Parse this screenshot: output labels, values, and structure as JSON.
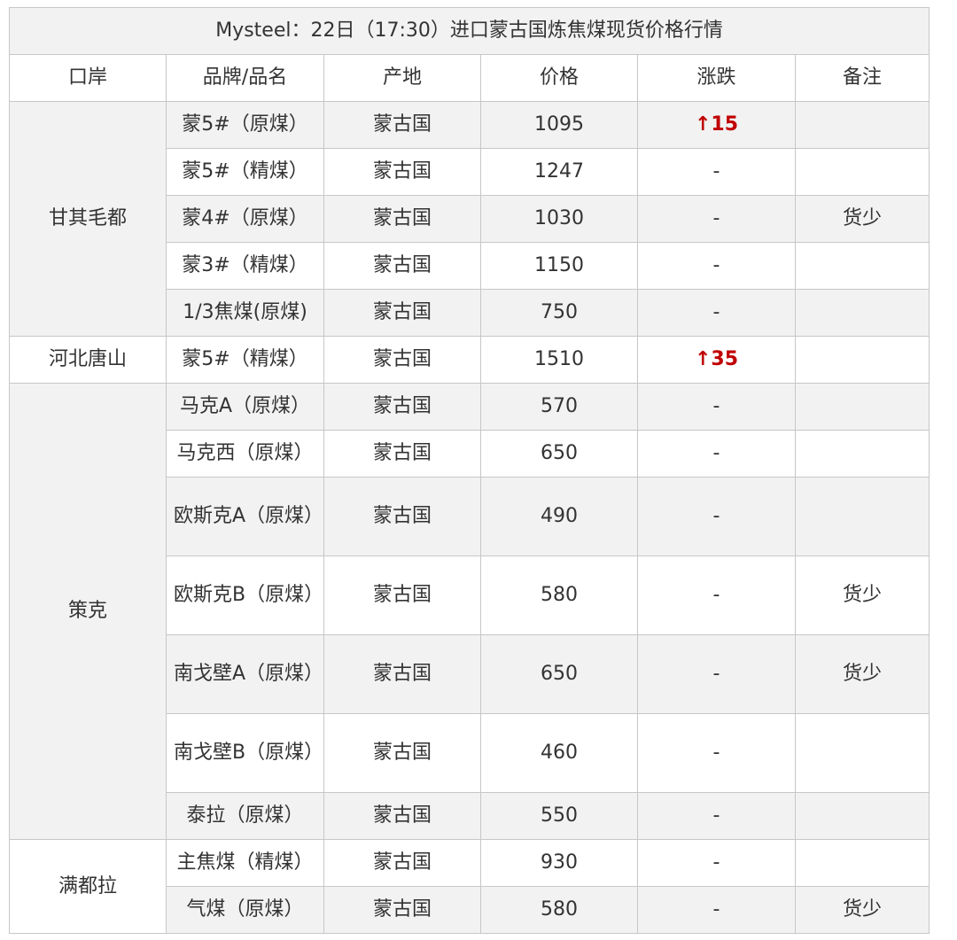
{
  "title": "Mysteel：22日（17:30）进口蒙古国炼焦煤现货价格行情",
  "columns": [
    "口岸",
    "品牌/品名",
    "产地",
    "价格",
    "涨跌",
    "备注"
  ],
  "up_color": "#c00000",
  "groups": [
    {
      "port": "甘其毛都",
      "rows": [
        {
          "brand": "蒙5#（原煤）",
          "origin": "蒙古国",
          "price": "1095",
          "change": "↑15",
          "note": ""
        },
        {
          "brand": "蒙5#（精煤）",
          "origin": "蒙古国",
          "price": "1247",
          "change": "-",
          "note": ""
        },
        {
          "brand": "蒙4#（原煤）",
          "origin": "蒙古国",
          "price": "1030",
          "change": "-",
          "note": "货少"
        },
        {
          "brand": "蒙3#（精煤）",
          "origin": "蒙古国",
          "price": "1150",
          "change": "-",
          "note": ""
        },
        {
          "brand": "1/3焦煤(原煤)",
          "origin": "蒙古国",
          "price": "750",
          "change": "-",
          "note": ""
        }
      ]
    },
    {
      "port": "河北唐山",
      "rows": [
        {
          "brand": "蒙5#（精煤）",
          "origin": "蒙古国",
          "price": "1510",
          "change": "↑35",
          "note": ""
        }
      ]
    },
    {
      "port": "策克",
      "rows": [
        {
          "brand": "马克A（原煤）",
          "origin": "蒙古国",
          "price": "570",
          "change": "-",
          "note": ""
        },
        {
          "brand": "马克西（原煤）",
          "origin": "蒙古国",
          "price": "650",
          "change": "-",
          "note": ""
        },
        {
          "brand": "欧斯克A（原煤）",
          "origin": "蒙古国",
          "price": "490",
          "change": "-",
          "note": ""
        },
        {
          "brand": "欧斯克B（原煤）",
          "origin": "蒙古国",
          "price": "580",
          "change": "-",
          "note": "货少"
        },
        {
          "brand": "南戈壁A（原煤）",
          "origin": "蒙古国",
          "price": "650",
          "change": "-",
          "note": "货少"
        },
        {
          "brand": "南戈壁B（原煤）",
          "origin": "蒙古国",
          "price": "460",
          "change": "-",
          "note": ""
        },
        {
          "brand": "泰拉（原煤）",
          "origin": "蒙古国",
          "price": "550",
          "change": "-",
          "note": ""
        }
      ]
    },
    {
      "port": "满都拉",
      "rows": [
        {
          "brand": "主焦煤（精煤）",
          "origin": "蒙古国",
          "price": "930",
          "change": "-",
          "note": ""
        },
        {
          "brand": "气煤（原煤）",
          "origin": "蒙古国",
          "price": "580",
          "change": "-",
          "note": "货少"
        }
      ]
    }
  ]
}
